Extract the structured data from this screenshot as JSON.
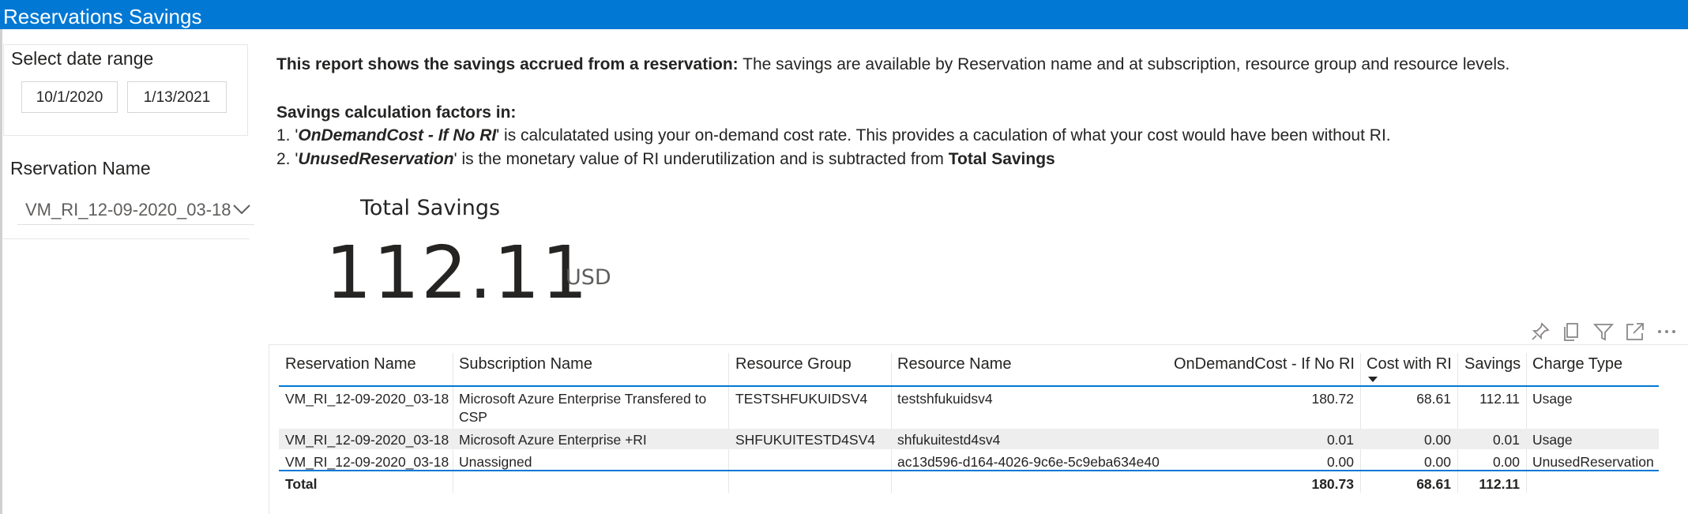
{
  "app": {
    "title": "Reservations Savings"
  },
  "date_filter": {
    "label": "Select date range",
    "start": "10/1/2020",
    "end": "1/13/2021"
  },
  "reservation_filter": {
    "label": "Rservation Name",
    "selected": "VM_RI_12-09-2020_03-18"
  },
  "description": {
    "line1_bold": "This report shows the savings accrued from a reservation:",
    "line1_rest": " The savings are available by Reservation name and at subscription, resource group and resource levels.",
    "factors_heading": "Savings calculation factors in:",
    "factor1_num": "1. '",
    "factor1_term": "OnDemandCost - If No RI",
    "factor1_rest": "' is calculatated using your on-demand cost rate. This provides a caculation of what your cost would have been without RI.",
    "factor2_num": "2. '",
    "factor2_term": "UnusedReservation",
    "factor2_mid": "' is the monetary value of RI underutilization and is subtracted from ",
    "factor2_end": "Total Savings"
  },
  "kpi": {
    "title": "Total Savings",
    "value": "112.11",
    "unit": "USD"
  },
  "toolbar_icons": [
    "pin-icon",
    "copy-icon",
    "filter-icon",
    "focus-mode-icon",
    "more-options-icon"
  ],
  "table": {
    "columns": [
      "Reservation Name",
      "Subscription Name",
      "Resource Group",
      "Resource Name",
      "OnDemandCost - If No RI",
      "Cost with RI",
      "Savings",
      "Charge Type"
    ],
    "sorted_column": "Cost with RI",
    "rows": [
      {
        "reservation": "VM_RI_12-09-2020_03-18",
        "subscription_l1": "Microsoft Azure Enterprise Transfered to",
        "subscription_l2": "CSP",
        "resource_group": "TESTSHFUKUIDSV4",
        "resource": "testshfukuidsv4",
        "ondemand": "180.72",
        "cost_ri": "68.61",
        "savings": "112.11",
        "charge": "Usage"
      },
      {
        "reservation": "VM_RI_12-09-2020_03-18",
        "subscription_l1": "Microsoft Azure Enterprise +RI",
        "subscription_l2": "",
        "resource_group": "SHFUKUITESTD4SV4",
        "resource": "shfukuitestd4sv4",
        "ondemand": "0.01",
        "cost_ri": "0.00",
        "savings": "0.01",
        "charge": "Usage"
      },
      {
        "reservation": "VM_RI_12-09-2020_03-18",
        "subscription_l1": "Unassigned",
        "subscription_l2": "",
        "resource_group": "",
        "resource": "ac13d596-d164-4026-9c6e-5c9eba634e40",
        "ondemand": "0.00",
        "cost_ri": "0.00",
        "savings": "0.00",
        "charge": "UnusedReservation"
      }
    ],
    "total": {
      "label": "Total",
      "ondemand": "180.73",
      "cost_ri": "68.61",
      "savings": "112.11"
    }
  },
  "colors": {
    "title_bar": "#0078d4",
    "header_rule": "#0078d4",
    "alt_row": "#eeeeee"
  }
}
